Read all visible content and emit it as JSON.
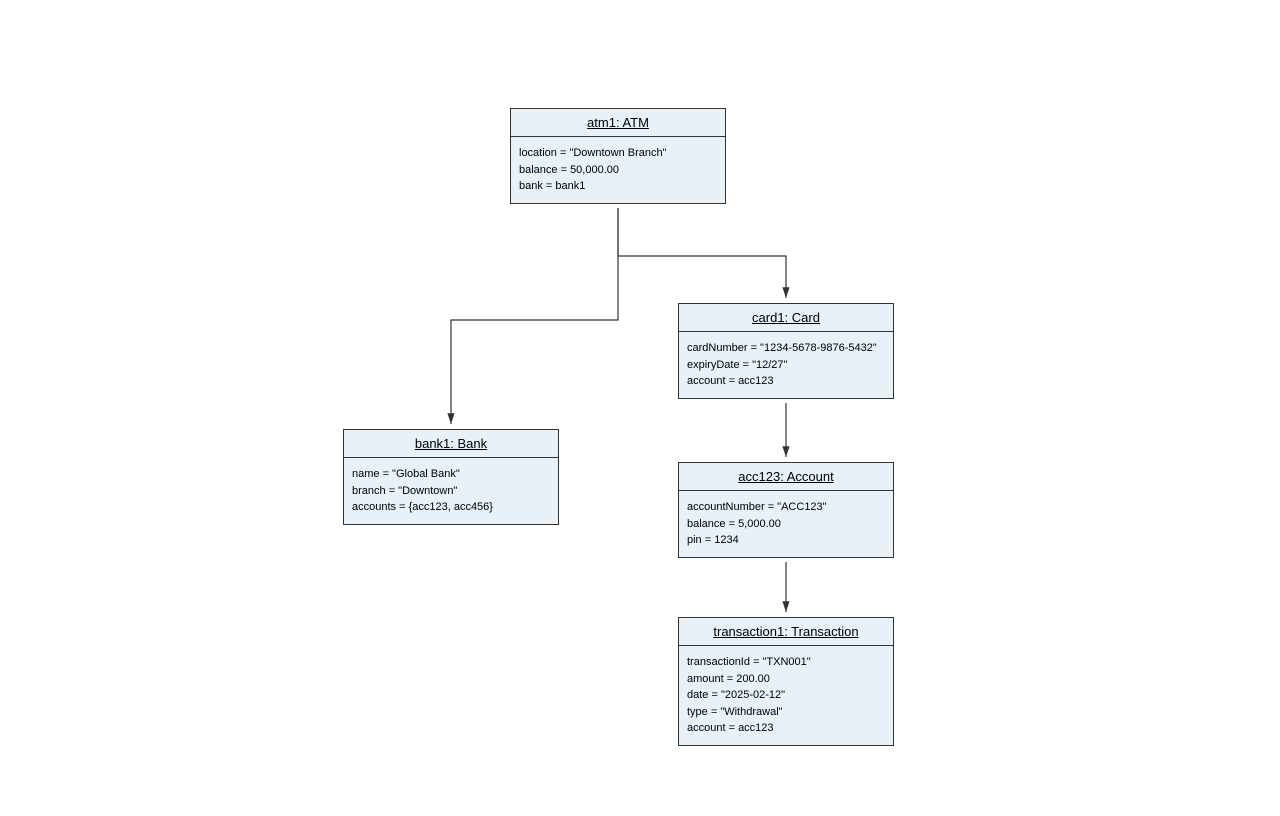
{
  "diagram": {
    "type": "object-diagram",
    "nodes": {
      "atm": {
        "title": "atm1: ATM",
        "attrs": [
          "location = \"Downtown Branch\"",
          "balance = 50,000.00",
          "bank = bank1"
        ]
      },
      "card": {
        "title": "card1: Card",
        "attrs": [
          "cardNumber = \"1234-5678-9876-5432\"",
          "expiryDate = \"12/27\"",
          "account = acc123"
        ]
      },
      "bank": {
        "title": "bank1: Bank",
        "attrs": [
          "name = \"Global Bank\"",
          "branch = \"Downtown\"",
          "accounts = {acc123, acc456}"
        ]
      },
      "account": {
        "title": "acc123: Account",
        "attrs": [
          "accountNumber = \"ACC123\"",
          "balance = 5,000.00",
          "pin = 1234"
        ]
      },
      "transaction": {
        "title": "transaction1: Transaction",
        "attrs": [
          "transactionId = \"TXN001\"",
          "amount = 200.00",
          "date = \"2025-02-12\"",
          "type = \"Withdrawal\"",
          "account = acc123"
        ]
      }
    },
    "edges": [
      {
        "from": "atm",
        "to": "bank"
      },
      {
        "from": "atm",
        "to": "card"
      },
      {
        "from": "card",
        "to": "account"
      },
      {
        "from": "account",
        "to": "transaction"
      }
    ]
  }
}
